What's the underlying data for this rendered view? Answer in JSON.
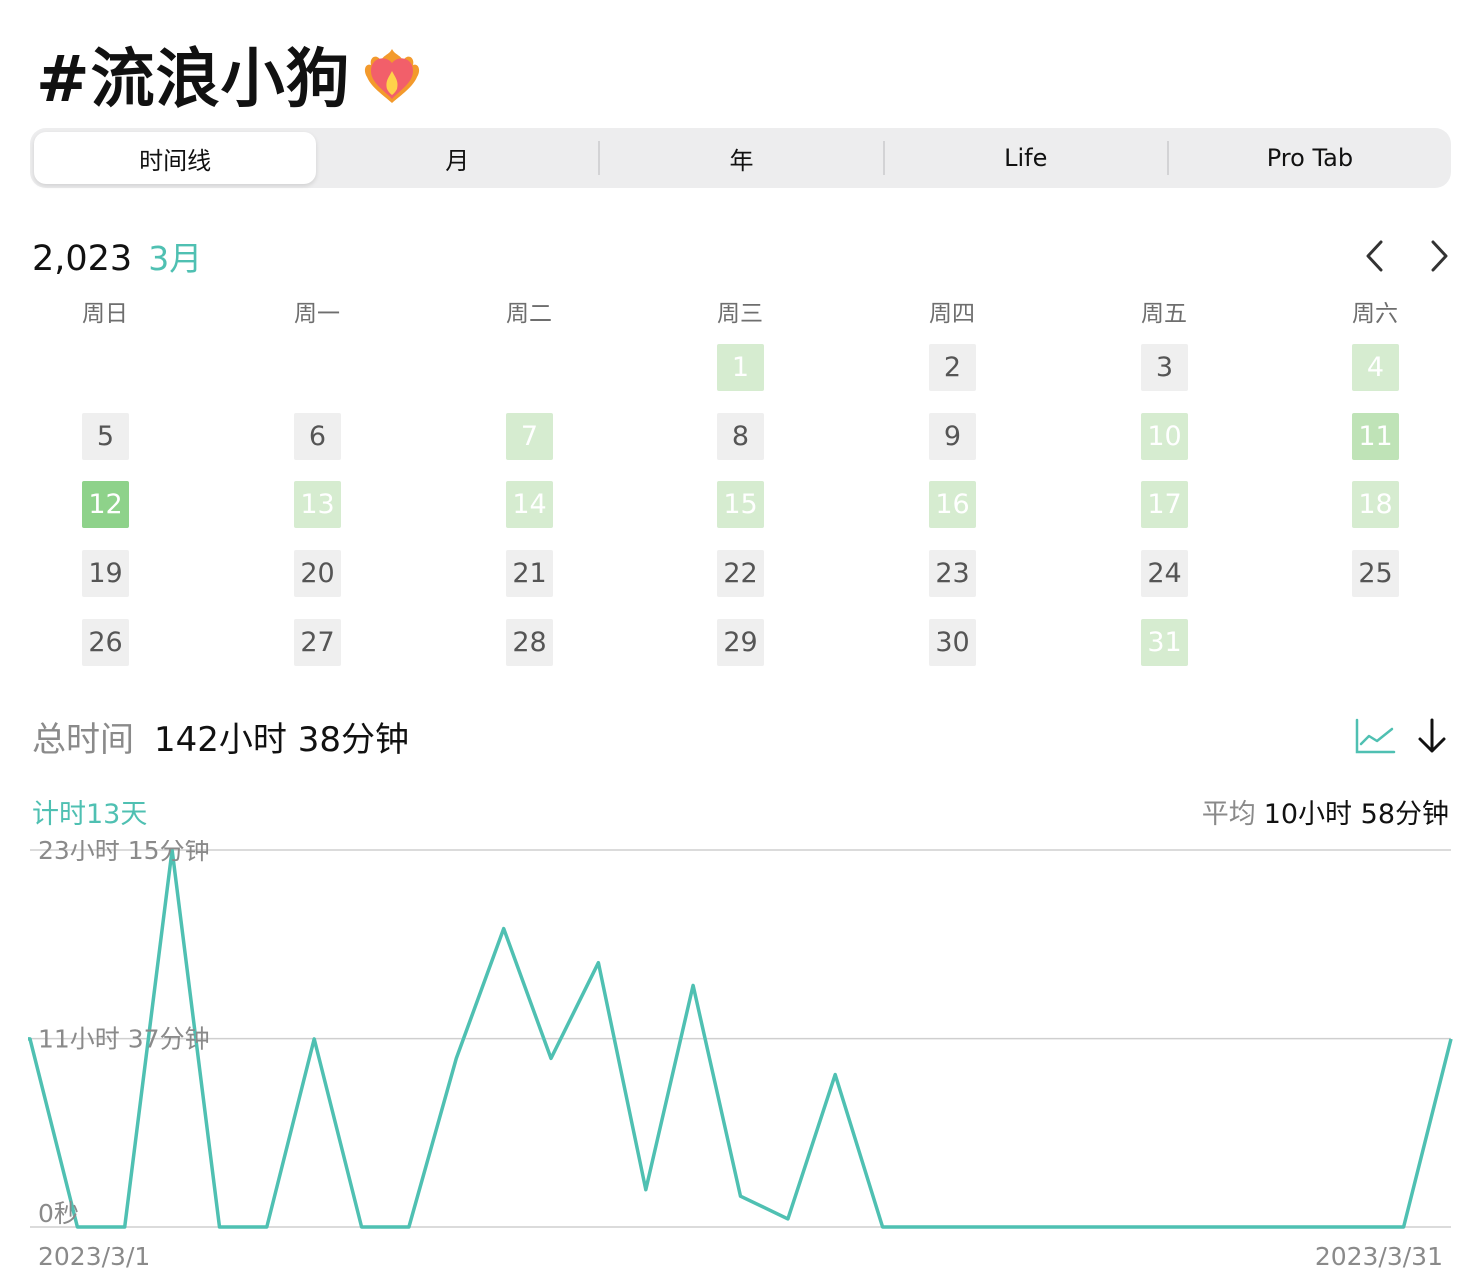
{
  "header": {
    "title": "#流浪小狗",
    "emoji": "heart-on-fire-icon"
  },
  "tabs": [
    {
      "label": "时间线",
      "active": true
    },
    {
      "label": "月",
      "active": false
    },
    {
      "label": "年",
      "active": false
    },
    {
      "label": "Life",
      "active": false
    },
    {
      "label": "Pro Tab",
      "active": false
    }
  ],
  "calendar": {
    "year": "2,023",
    "month": "3月",
    "weekdays": [
      "周日",
      "周一",
      "周二",
      "周三",
      "周四",
      "周五",
      "周六"
    ],
    "first_weekday": 3,
    "days": [
      {
        "day": "1",
        "level": 1
      },
      {
        "day": "2",
        "level": 0
      },
      {
        "day": "3",
        "level": 0
      },
      {
        "day": "4",
        "level": 1
      },
      {
        "day": "5",
        "level": 0
      },
      {
        "day": "6",
        "level": 0
      },
      {
        "day": "7",
        "level": 1
      },
      {
        "day": "8",
        "level": 0
      },
      {
        "day": "9",
        "level": 0
      },
      {
        "day": "10",
        "level": 1
      },
      {
        "day": "11",
        "level": 2
      },
      {
        "day": "12",
        "level": 3
      },
      {
        "day": "13",
        "level": 1
      },
      {
        "day": "14",
        "level": 1
      },
      {
        "day": "15",
        "level": 1
      },
      {
        "day": "16",
        "level": 1
      },
      {
        "day": "17",
        "level": 1
      },
      {
        "day": "18",
        "level": 1
      },
      {
        "day": "19",
        "level": 0
      },
      {
        "day": "20",
        "level": 0
      },
      {
        "day": "21",
        "level": 0
      },
      {
        "day": "22",
        "level": 0
      },
      {
        "day": "23",
        "level": 0
      },
      {
        "day": "24",
        "level": 0
      },
      {
        "day": "25",
        "level": 0
      },
      {
        "day": "26",
        "level": 0
      },
      {
        "day": "27",
        "level": 0
      },
      {
        "day": "28",
        "level": 0
      },
      {
        "day": "29",
        "level": 0
      },
      {
        "day": "30",
        "level": 0
      },
      {
        "day": "31",
        "level": 1
      }
    ]
  },
  "summary": {
    "total_label": "总时间",
    "total_value": "142小时 38分钟",
    "days_label": "计时13天",
    "avg_label": "平均",
    "avg_value": "10小时 58分钟"
  },
  "colors": {
    "accent": "#4fc0b2"
  },
  "chart_data": {
    "type": "line",
    "x": [
      "2023/3/1",
      "2023/3/2",
      "2023/3/3",
      "2023/3/4",
      "2023/3/5",
      "2023/3/6",
      "2023/3/7",
      "2023/3/8",
      "2023/3/9",
      "2023/3/10",
      "2023/3/11",
      "2023/3/12",
      "2023/3/13",
      "2023/3/14",
      "2023/3/15",
      "2023/3/16",
      "2023/3/17",
      "2023/3/18",
      "2023/3/19",
      "2023/3/20",
      "2023/3/21",
      "2023/3/22",
      "2023/3/23",
      "2023/3/24",
      "2023/3/25",
      "2023/3/26",
      "2023/3/27",
      "2023/3/28",
      "2023/3/29",
      "2023/3/30",
      "2023/3/31"
    ],
    "series": [
      {
        "values": [
          11.6,
          0,
          0,
          23.25,
          0,
          0,
          11.6,
          0,
          0,
          10.4,
          18.4,
          10.4,
          16.3,
          2.3,
          14.9,
          1.9,
          0.5,
          9.4,
          0,
          0,
          0,
          0,
          0,
          0,
          0,
          0,
          0,
          0,
          0,
          0,
          11.6
        ]
      }
    ],
    "y_ticks": [
      "23小时 15分钟",
      "11小时 37分钟",
      "0秒"
    ],
    "y_tick_values": [
      23.25,
      11.617,
      0
    ],
    "ylim": [
      0,
      23.25
    ],
    "x_tick_labels": [
      "2023/3/1",
      "2023/3/31"
    ],
    "grid": true
  }
}
